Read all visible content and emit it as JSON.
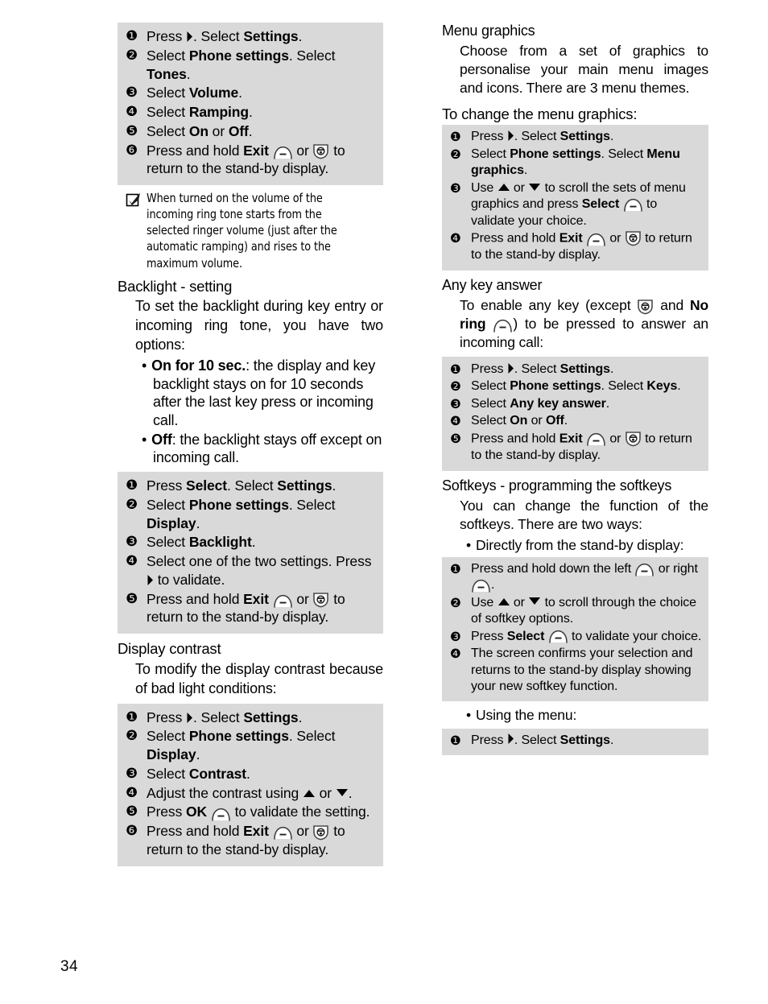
{
  "page": {
    "number": "34"
  },
  "icons": {
    "softkey": "softkey-arc-icon",
    "hangup": "hangup-phone-icon",
    "right": "right-arrow-icon",
    "up": "up-arrow-icon",
    "down": "down-arrow-icon",
    "check": "checkbox-check-icon"
  },
  "left_column": {
    "ramping_proc": {
      "steps": [
        {
          "num": "1",
          "parts": [
            {
              "t": "Press "
            },
            {
              "icon": "right"
            },
            {
              "t": ". Select "
            },
            {
              "b": "Settings"
            },
            {
              "t": "."
            }
          ]
        },
        {
          "num": "2",
          "parts": [
            {
              "t": "Select "
            },
            {
              "b": "Phone settings"
            },
            {
              "t": ". Select "
            },
            {
              "b": "Tones"
            },
            {
              "t": "."
            }
          ]
        },
        {
          "num": "3",
          "parts": [
            {
              "t": "Select "
            },
            {
              "b": "Volume"
            },
            {
              "t": "."
            }
          ]
        },
        {
          "num": "4",
          "parts": [
            {
              "t": "Select "
            },
            {
              "b": "Ramping"
            },
            {
              "t": "."
            }
          ]
        },
        {
          "num": "5",
          "parts": [
            {
              "t": "Select "
            },
            {
              "b": "On"
            },
            {
              "t": " or "
            },
            {
              "b": "Off"
            },
            {
              "t": "."
            }
          ]
        },
        {
          "num": "6",
          "parts": [
            {
              "t": "Press and hold "
            },
            {
              "b": "Exit"
            },
            {
              "t": " "
            },
            {
              "icon": "softkey"
            },
            {
              "t": " or "
            },
            {
              "icon": "hangup"
            },
            {
              "t": " to return to the stand-by display."
            }
          ]
        }
      ]
    },
    "note": "When turned on the volume of the incoming ring tone starts from the selected ringer volume (just after the automatic ramping) and rises to the maximum volume.",
    "backlight": {
      "heading": "Backlight - setting",
      "intro": "To set the backlight during key entry or incoming ring tone, you have two options:",
      "bullets": [
        {
          "bold": "On for 10 sec.",
          "rest": ": the display and key backlight stays on for 10 seconds after the last key press or incoming call."
        },
        {
          "bold": "Off",
          "rest": ": the backlight stays off except on incoming call."
        }
      ],
      "proc": {
        "steps": [
          {
            "num": "1",
            "parts": [
              {
                "t": "Press "
              },
              {
                "b": "Select"
              },
              {
                "t": ". Select "
              },
              {
                "b": "Settings"
              },
              {
                "t": "."
              }
            ]
          },
          {
            "num": "2",
            "parts": [
              {
                "t": "Select "
              },
              {
                "b": "Phone settings"
              },
              {
                "t": ". Select "
              },
              {
                "b": "Display"
              },
              {
                "t": "."
              }
            ]
          },
          {
            "num": "3",
            "parts": [
              {
                "t": "Select "
              },
              {
                "b": "Backlight"
              },
              {
                "t": "."
              }
            ]
          },
          {
            "num": "4",
            "parts": [
              {
                "t": "Select one of the two settings. Press "
              },
              {
                "icon": "right"
              },
              {
                "t": " to validate."
              }
            ]
          },
          {
            "num": "5",
            "parts": [
              {
                "t": "Press and hold "
              },
              {
                "b": "Exit"
              },
              {
                "t": " "
              },
              {
                "icon": "softkey"
              },
              {
                "t": " or "
              },
              {
                "icon": "hangup"
              },
              {
                "t": " to return to the stand-by display."
              }
            ]
          }
        ]
      }
    },
    "contrast": {
      "heading": "Display contrast",
      "intro": "To modify the display contrast because of bad light conditions:",
      "proc": {
        "steps": [
          {
            "num": "1",
            "parts": [
              {
                "t": "Press "
              },
              {
                "icon": "right"
              },
              {
                "t": ". Select "
              },
              {
                "b": "Settings"
              },
              {
                "t": "."
              }
            ]
          },
          {
            "num": "2",
            "parts": [
              {
                "t": "Select "
              },
              {
                "b": "Phone settings"
              },
              {
                "t": ". Select "
              },
              {
                "b": "Display"
              },
              {
                "t": "."
              }
            ]
          },
          {
            "num": "3",
            "parts": [
              {
                "t": "Select "
              },
              {
                "b": "Contrast"
              },
              {
                "t": "."
              }
            ]
          },
          {
            "num": "4",
            "parts": [
              {
                "t": "Adjust the contrast using "
              },
              {
                "icon": "up"
              },
              {
                "t": " or "
              },
              {
                "icon": "down"
              },
              {
                "t": "."
              }
            ]
          },
          {
            "num": "5",
            "parts": [
              {
                "t": "Press "
              },
              {
                "b": "OK"
              },
              {
                "t": " "
              },
              {
                "icon": "softkey"
              },
              {
                "t": " to validate the setting."
              }
            ]
          },
          {
            "num": "6",
            "parts": [
              {
                "t": "Press and hold "
              },
              {
                "b": "Exit"
              },
              {
                "t": " "
              },
              {
                "icon": "softkey"
              },
              {
                "t": " or "
              },
              {
                "icon": "hangup"
              },
              {
                "t": " to return to the stand-by display."
              }
            ]
          }
        ]
      }
    }
  },
  "right_column": {
    "menu_graphics": {
      "heading": "Menu graphics",
      "intro": "Choose from a set of graphics to personalise your main menu images and icons. There are 3 menu themes.",
      "lead": "To change the menu graphics:",
      "proc": {
        "steps": [
          {
            "num": "1",
            "parts": [
              {
                "t": "Press "
              },
              {
                "icon": "right"
              },
              {
                "t": ". Select "
              },
              {
                "b": "Settings"
              },
              {
                "t": "."
              }
            ]
          },
          {
            "num": "2",
            "parts": [
              {
                "t": "Select "
              },
              {
                "b": "Phone settings"
              },
              {
                "t": ". Select "
              },
              {
                "b": "Menu graphics"
              },
              {
                "t": "."
              }
            ]
          },
          {
            "num": "3",
            "parts": [
              {
                "t": "Use "
              },
              {
                "icon": "up"
              },
              {
                "t": " or "
              },
              {
                "icon": "down"
              },
              {
                "t": " to scroll the sets of menu graphics and press "
              },
              {
                "b": "Select"
              },
              {
                "t": " "
              },
              {
                "icon": "softkey"
              },
              {
                "t": " to validate your choice."
              }
            ]
          },
          {
            "num": "4",
            "parts": [
              {
                "t": "Press and hold "
              },
              {
                "b": "Exit"
              },
              {
                "t": " "
              },
              {
                "icon": "softkey"
              },
              {
                "t": " or "
              },
              {
                "icon": "hangup"
              },
              {
                "t": " to return to the stand-by display."
              }
            ]
          }
        ]
      }
    },
    "any_key": {
      "heading": "Any key answer",
      "intro_parts": [
        {
          "t": "To enable any key (except "
        },
        {
          "icon": "hangup"
        },
        {
          "t": " and "
        },
        {
          "b": "No ring"
        },
        {
          "t": " "
        },
        {
          "icon": "softkey"
        },
        {
          "t": ") to be pressed to answer an incoming call:"
        }
      ],
      "proc": {
        "steps": [
          {
            "num": "1",
            "parts": [
              {
                "t": "Press "
              },
              {
                "icon": "right"
              },
              {
                "t": ". Select "
              },
              {
                "b": "Settings"
              },
              {
                "t": "."
              }
            ]
          },
          {
            "num": "2",
            "parts": [
              {
                "t": "Select "
              },
              {
                "b": "Phone settings"
              },
              {
                "t": ". Select "
              },
              {
                "b": "Keys"
              },
              {
                "t": "."
              }
            ]
          },
          {
            "num": "3",
            "parts": [
              {
                "t": "Select "
              },
              {
                "b": "Any key answer"
              },
              {
                "t": "."
              }
            ]
          },
          {
            "num": "4",
            "parts": [
              {
                "t": "Select "
              },
              {
                "b": "On"
              },
              {
                "t": " or "
              },
              {
                "b": "Off"
              },
              {
                "t": "."
              }
            ]
          },
          {
            "num": "5",
            "parts": [
              {
                "t": "Press and hold "
              },
              {
                "b": "Exit"
              },
              {
                "t": " "
              },
              {
                "icon": "softkey"
              },
              {
                "t": " or "
              },
              {
                "icon": "hangup"
              },
              {
                "t": " to return to the stand-by display."
              }
            ]
          }
        ]
      }
    },
    "softkeys": {
      "heading": "Softkeys - programming the softkeys",
      "intro": "You can change the function of the softkeys. There are two ways:",
      "bullet_direct": "Directly from the stand-by display:",
      "proc_direct": {
        "steps": [
          {
            "num": "1",
            "parts": [
              {
                "t": "Press and hold down the left "
              },
              {
                "icon": "softkey"
              },
              {
                "t": " or right "
              },
              {
                "icon": "softkey"
              },
              {
                "t": "."
              }
            ]
          },
          {
            "num": "2",
            "parts": [
              {
                "t": "Use "
              },
              {
                "icon": "up"
              },
              {
                "t": " or "
              },
              {
                "icon": "down"
              },
              {
                "t": " to scroll through the choice of softkey options."
              }
            ]
          },
          {
            "num": "3",
            "parts": [
              {
                "t": "Press "
              },
              {
                "b": "Select"
              },
              {
                "t": " "
              },
              {
                "icon": "softkey"
              },
              {
                "t": " to validate your choice."
              }
            ]
          },
          {
            "num": "4",
            "parts": [
              {
                "t": "The screen confirms your selection and returns to the stand-by display showing your new softkey function."
              }
            ]
          }
        ]
      },
      "bullet_menu": "Using the menu:",
      "proc_menu": {
        "steps": [
          {
            "num": "1",
            "parts": [
              {
                "t": "Press "
              },
              {
                "icon": "right"
              },
              {
                "t": ". Select "
              },
              {
                "b": "Settings"
              },
              {
                "t": "."
              }
            ]
          }
        ]
      }
    }
  }
}
